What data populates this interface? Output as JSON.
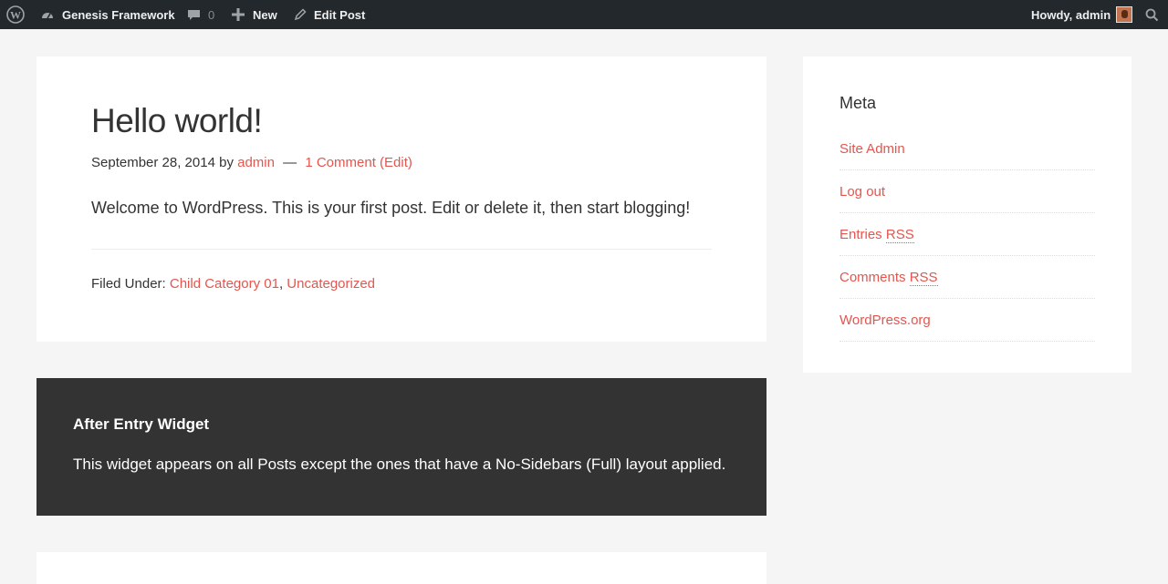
{
  "adminbar": {
    "site_name": "Genesis Framework",
    "comment_count": "0",
    "new_label": "New",
    "edit_label": "Edit Post",
    "howdy": "Howdy, admin"
  },
  "post": {
    "title": "Hello world!",
    "date": "September 28, 2014",
    "by": "by",
    "author": "admin",
    "separator": "—",
    "comments_link": "1 Comment",
    "edit_link": "(Edit)",
    "content": "Welcome to WordPress. This is your first post. Edit or delete it, then start blogging!",
    "filed_under": "Filed Under:",
    "categories": [
      "Child Category 01",
      "Uncategorized"
    ]
  },
  "after_entry": {
    "title": "After Entry Widget",
    "text": "This widget appears on all Posts except the ones that have a No-Sidebars (Full) layout applied."
  },
  "sidebar": {
    "title": "Meta",
    "items": [
      {
        "label": "Site Admin"
      },
      {
        "label": "Log out"
      },
      {
        "prefix": "Entries ",
        "abbr": "RSS"
      },
      {
        "prefix": "Comments ",
        "abbr": "RSS"
      },
      {
        "label": "WordPress.org"
      }
    ]
  },
  "colors": {
    "accent": "#e5554e",
    "adminbar": "#23282d",
    "dark_widget": "#333333",
    "background": "#f5f5f5"
  }
}
